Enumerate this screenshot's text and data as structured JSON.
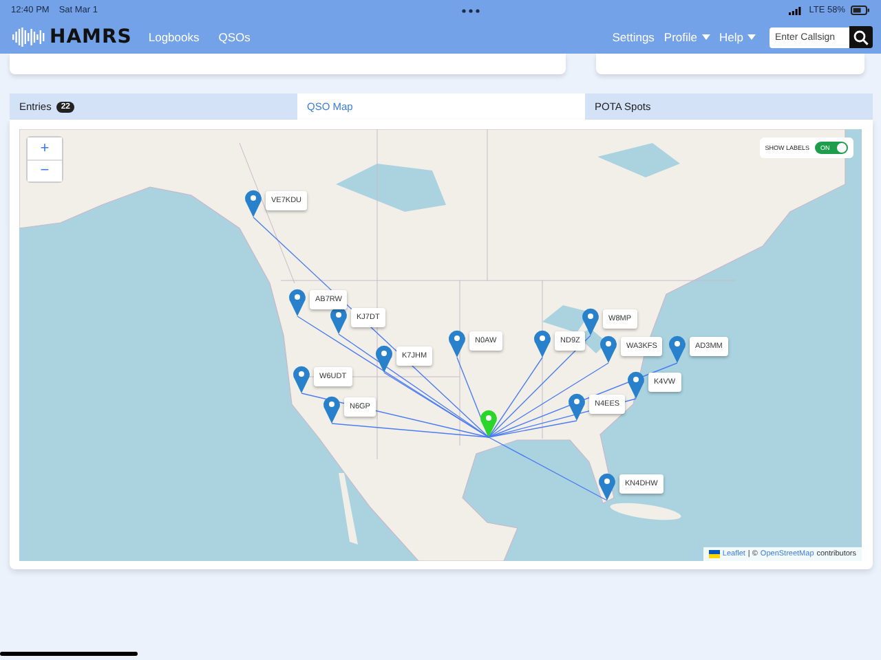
{
  "status_bar": {
    "time": "12:40 PM",
    "date": "Sat Mar 1",
    "network": "LTE 58%"
  },
  "navbar": {
    "brand": "HAMRS",
    "links": [
      {
        "label": "Logbooks",
        "dropdown": false
      },
      {
        "label": "QSOs",
        "dropdown": false
      }
    ],
    "right_links": [
      {
        "label": "Settings",
        "dropdown": false
      },
      {
        "label": "Profile",
        "dropdown": true
      },
      {
        "label": "Help",
        "dropdown": true
      }
    ],
    "search": {
      "placeholder": "Enter Callsign"
    }
  },
  "tabs": [
    {
      "label": "Entries",
      "badge": "22",
      "selected": false
    },
    {
      "label": "QSO Map",
      "selected": true
    },
    {
      "label": "POTA Spots",
      "selected": false
    }
  ],
  "map": {
    "zoom_in": "+",
    "zoom_out": "−",
    "show_labels": {
      "label": "SHOW LABELS",
      "on": true,
      "text": "ON"
    },
    "markers": [
      {
        "label": "VE7KDU",
        "kind": "contact"
      },
      {
        "label": "AB7RW",
        "kind": "contact"
      },
      {
        "label": "KJ7DT",
        "kind": "contact"
      },
      {
        "label": "K7JHM",
        "kind": "contact"
      },
      {
        "label": "N0AW",
        "kind": "contact"
      },
      {
        "label": "W6UDT",
        "kind": "contact"
      },
      {
        "label": "N6GP",
        "kind": "contact"
      },
      {
        "label": "ND9Z",
        "kind": "contact"
      },
      {
        "label": "W8MP",
        "kind": "contact"
      },
      {
        "label": "WA3KFS",
        "kind": "contact"
      },
      {
        "label": "AD3MM",
        "kind": "contact"
      },
      {
        "label": "K4VW",
        "kind": "contact"
      },
      {
        "label": "N4EES",
        "kind": "contact"
      },
      {
        "label": "KN4DHW",
        "kind": "contact"
      },
      {
        "kind": "home"
      }
    ],
    "attribution": {
      "leaflet": "Leaflet",
      "separator": "| ©",
      "osm": "OpenStreetMap",
      "suffix": "contributors"
    }
  }
}
